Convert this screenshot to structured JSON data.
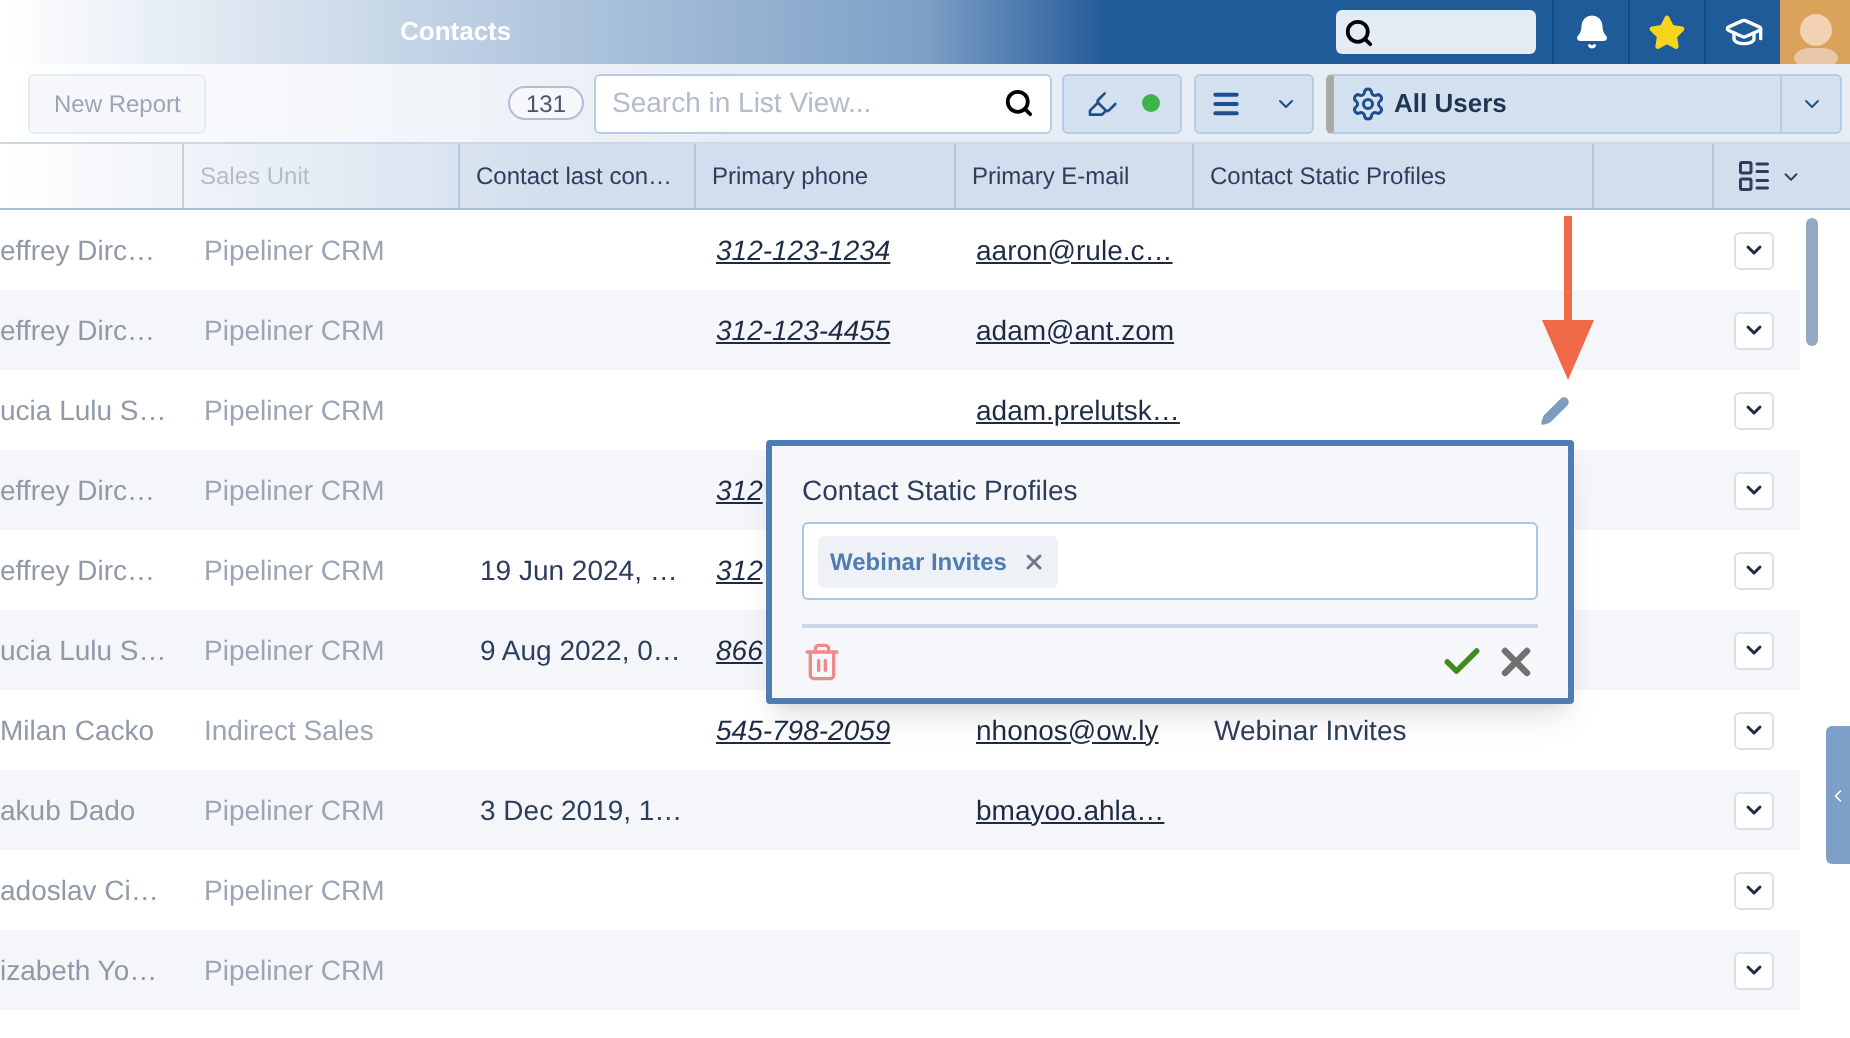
{
  "topbar": {
    "title": "Contacts"
  },
  "toolbar": {
    "new_report": "New Report",
    "count": "131",
    "search": {
      "placeholder": "Search in List View..."
    },
    "status_dot": {
      "color": "#3cb44b"
    },
    "user_filter": "All Users"
  },
  "table": {
    "columns": [
      "Sales Unit",
      "Contact last con…",
      "Primary phone",
      "Primary E-mail",
      "Contact Static Profiles"
    ],
    "rows": [
      {
        "name": "effrey Dirc…",
        "sales_unit": "Pipeliner CRM",
        "phone": "312-123-1234",
        "email": "aaron@rule.c…"
      },
      {
        "name": "effrey Dirc…",
        "sales_unit": "Pipeliner CRM",
        "phone": "312-123-4455",
        "email": "adam@ant.zom"
      },
      {
        "name": "ucia Lulu S…",
        "sales_unit": "Pipeliner CRM",
        "email": "adam.prelutsk…",
        "editing": true
      },
      {
        "name": "effrey Dirc…",
        "sales_unit": "Pipeliner CRM",
        "phone": "312"
      },
      {
        "name": "effrey Dirc…",
        "sales_unit": "Pipeliner CRM",
        "last_contact": "19 Jun 2024, …",
        "phone": "312"
      },
      {
        "name": "ucia Lulu S…",
        "sales_unit": "Pipeliner CRM",
        "last_contact": "9 Aug 2022, 0…",
        "phone": "866"
      },
      {
        "name": "Milan Cacko",
        "sales_unit": "Indirect Sales",
        "phone": "545-798-2059",
        "email": "nhonos@ow.ly",
        "profiles": "Webinar Invites"
      },
      {
        "name": "akub Dado",
        "sales_unit": "Pipeliner CRM",
        "last_contact": "3 Dec 2019, 1…",
        "email": "bmayoo.ahla…"
      },
      {
        "name": "adoslav Ci…",
        "sales_unit": "Pipeliner CRM"
      },
      {
        "name": "izabeth Yo…",
        "sales_unit": "Pipeliner CRM"
      }
    ]
  },
  "popup": {
    "label": "Contact Static Profiles",
    "tags": [
      "Webinar Invites"
    ]
  }
}
